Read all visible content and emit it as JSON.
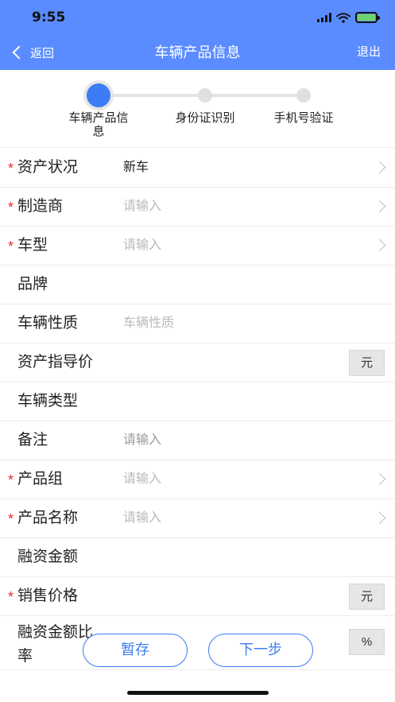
{
  "status_bar": {
    "time": "9:55"
  },
  "nav": {
    "back_label": "返回",
    "title": "车辆产品信息",
    "exit_label": "退出"
  },
  "stepper": {
    "steps": [
      {
        "label_line1": "车辆产品信",
        "label_line2": "息",
        "state": "active"
      },
      {
        "label_line1": "身份证识别",
        "label_line2": "",
        "state": "pending"
      },
      {
        "label_line1": "手机号验证",
        "label_line2": "",
        "state": "pending"
      }
    ]
  },
  "form": {
    "required_mark": "*",
    "rows": [
      {
        "label": "资产状况",
        "value": "新车",
        "placeholder": "",
        "required": true
      },
      {
        "label": "制造商",
        "value": "",
        "placeholder": "请输入",
        "required": true
      },
      {
        "label": "车型",
        "value": "",
        "placeholder": "请输入",
        "required": true
      },
      {
        "label": "品牌",
        "value": "",
        "placeholder": "",
        "required": false
      },
      {
        "label": "车辆性质",
        "value": "",
        "placeholder": "车辆性质",
        "required": false
      },
      {
        "label": "资产指导价",
        "value": "",
        "placeholder": "",
        "required": false,
        "unit": "元"
      },
      {
        "label": "车辆类型",
        "value": "",
        "placeholder": "",
        "required": false
      },
      {
        "label": "备注",
        "value": "",
        "placeholder": "请输入",
        "required": false
      },
      {
        "label": "产品组",
        "value": "",
        "placeholder": "请输入",
        "required": true
      },
      {
        "label": "产品名称",
        "value": "",
        "placeholder": "请输入",
        "required": true
      },
      {
        "label": "融资金额",
        "value": "",
        "placeholder": "",
        "required": false
      },
      {
        "label": "销售价格",
        "value": "",
        "placeholder": "",
        "required": true,
        "unit": "元"
      },
      {
        "label_line1": "融资金额比",
        "label_line2": "率",
        "value": "",
        "placeholder": "",
        "required": false,
        "unit": "%"
      }
    ]
  },
  "actions": {
    "save_draft_label": "暂存",
    "next_label": "下一步"
  },
  "colors": {
    "header_bg": "#5b8cff",
    "accent": "#3c7cf5",
    "required": "#e0322b"
  }
}
